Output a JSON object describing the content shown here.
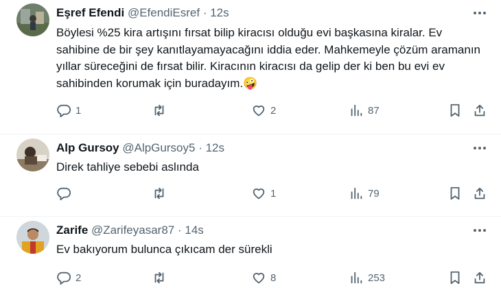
{
  "tweets": [
    {
      "name": "Eşref Efendi",
      "handle": "@EfendiEsref",
      "separator": "·",
      "time": "12s",
      "text": "Böylesi %25 kira artışını fırsat bilip kiracısı olduğu evi başkasına kiralar. Ev sahibine de bir şey kanıtlayamayacağını iddia eder. Mahkemeyle çözüm aramanın yıllar süreceğini de fırsat bilir. Kiracının kiracısı da gelip der ki ben bu evi ev sahibinden korumak için buradayım.",
      "emoji": "🤪",
      "replies": "1",
      "retweets": "",
      "likes": "2",
      "views": "87"
    },
    {
      "name": "Alp Gursoy",
      "handle": "@AlpGursoy5",
      "separator": "·",
      "time": "12s",
      "text": "Direk tahliye sebebi aslında",
      "replies": "",
      "retweets": "",
      "likes": "1",
      "views": "79"
    },
    {
      "name": "Zarife",
      "handle": "@Zarifeyasar87",
      "separator": "·",
      "time": "14s",
      "text": "Ev bakıyorum bulunca çıkıcam der sürekli",
      "replies": "2",
      "retweets": "",
      "likes": "8",
      "views": "253"
    }
  ],
  "colors": {
    "text": "#0f1419",
    "secondary": "#536471",
    "divider": "#eff3f4"
  }
}
